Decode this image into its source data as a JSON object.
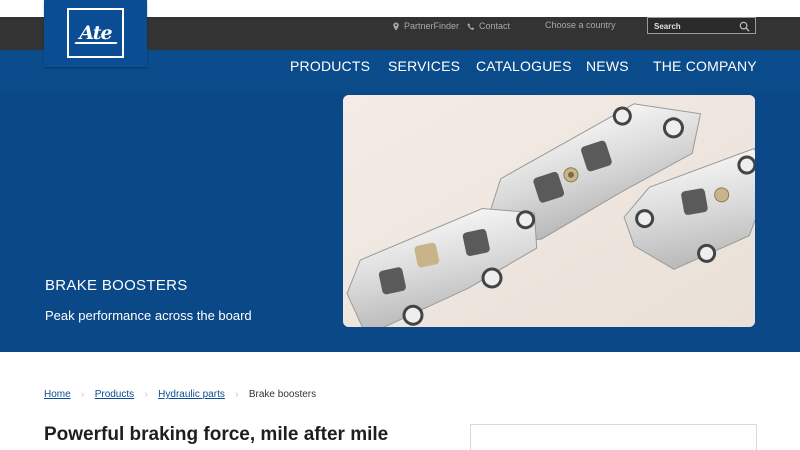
{
  "brand": {
    "logo_text": "Ate"
  },
  "utility": {
    "partner_finder": "PartnerFinder",
    "contact": "Contact",
    "country": "Choose a country",
    "search_placeholder": "Search"
  },
  "nav": {
    "items": [
      {
        "label": "PRODUCTS"
      },
      {
        "label": "SERVICES"
      },
      {
        "label": "CATALOGUES"
      },
      {
        "label": "NEWS"
      },
      {
        "label": "THE COMPANY"
      }
    ]
  },
  "hero": {
    "title": "BRAKE BOOSTERS",
    "subtitle": "Peak performance across the board",
    "image_subject": "brake-calipers-photo"
  },
  "breadcrumb": {
    "items": [
      {
        "label": "Home"
      },
      {
        "label": "Products"
      },
      {
        "label": "Hydraulic parts"
      }
    ],
    "current": "Brake boosters"
  },
  "main": {
    "title": "Powerful braking force, mile after mile"
  },
  "colors": {
    "brand_blue": "#0b4d95",
    "hero_blue": "#0b4887",
    "utility_bar": "#333333"
  }
}
